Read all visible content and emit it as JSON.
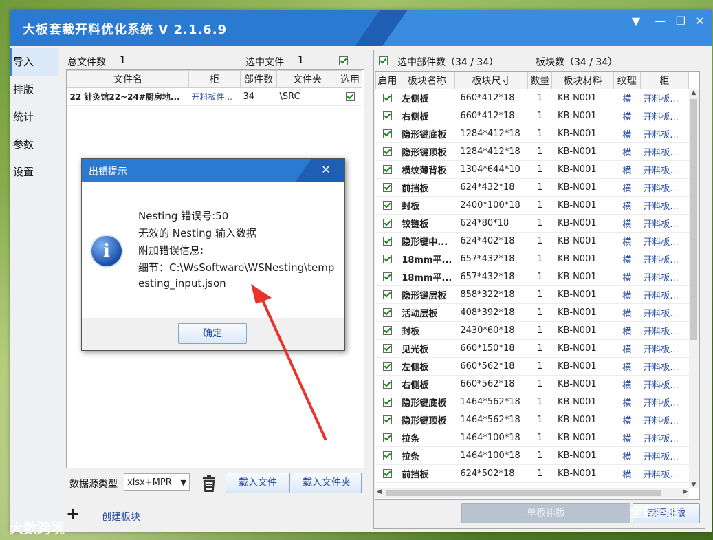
{
  "app": {
    "title": "大板套裁开料优化系统 V 2.1.6.9"
  },
  "window_controls": {
    "menu": "▼",
    "minimize": "—",
    "restore": "❐",
    "close": "✕"
  },
  "sidebar": {
    "items": [
      {
        "label": "导入",
        "active": true
      },
      {
        "label": "排版"
      },
      {
        "label": "统计"
      },
      {
        "label": "参数"
      },
      {
        "label": "设置"
      }
    ]
  },
  "left_panel": {
    "total_files_label": "总文件数",
    "total_files_value": "1",
    "selected_files_label": "选中文件",
    "selected_files_value": "1",
    "columns": [
      "文件名",
      "柜",
      "部件数",
      "文件夹",
      "选用"
    ],
    "rows": [
      {
        "name": "22 针灸馆22~24#厨房地...",
        "cabinet": "开料板件...",
        "count": "34",
        "folder": "\\SRC",
        "checked": true
      }
    ],
    "source_type_label": "数据源类型",
    "source_type_value": "xlsx+MPR",
    "load_file_button": "载入文件",
    "load_folder_button": "载入文件夹",
    "create_block_label": "创建板块"
  },
  "right_panel": {
    "selected_parts_label": "选中部件数（34 / 34）",
    "board_count_label": "板块数（34 / 34）",
    "columns": [
      "启用",
      "板块名称",
      "板块尺寸",
      "数量",
      "板块材料",
      "纹理",
      "柜"
    ],
    "rows": [
      {
        "name": "左侧板",
        "size": "660*412*18",
        "qty": "1",
        "material": "KB-N001",
        "grain": "横",
        "cabinet": "开料板..."
      },
      {
        "name": "右侧板",
        "size": "660*412*18",
        "qty": "1",
        "material": "KB-N001",
        "grain": "横",
        "cabinet": "开料板..."
      },
      {
        "name": "隐形键底板",
        "size": "1284*412*18",
        "qty": "1",
        "material": "KB-N001",
        "grain": "横",
        "cabinet": "开料板..."
      },
      {
        "name": "隐形键顶板",
        "size": "1284*412*18",
        "qty": "1",
        "material": "KB-N001",
        "grain": "横",
        "cabinet": "开料板..."
      },
      {
        "name": "横纹薄背板",
        "size": "1304*644*10",
        "qty": "1",
        "material": "KB-N001",
        "grain": "横",
        "cabinet": "开料板..."
      },
      {
        "name": "前挡板",
        "size": "624*432*18",
        "qty": "1",
        "material": "KB-N001",
        "grain": "横",
        "cabinet": "开料板..."
      },
      {
        "name": "封板",
        "size": "2400*100*18",
        "qty": "1",
        "material": "KB-N001",
        "grain": "横",
        "cabinet": "开料板..."
      },
      {
        "name": "铰链板",
        "size": "624*80*18",
        "qty": "1",
        "material": "KB-N001",
        "grain": "横",
        "cabinet": "开料板..."
      },
      {
        "name": "隐形键中...",
        "size": "624*402*18",
        "qty": "1",
        "material": "KB-N001",
        "grain": "横",
        "cabinet": "开料板..."
      },
      {
        "name": "18mm平...",
        "size": "657*432*18",
        "qty": "1",
        "material": "KB-N001",
        "grain": "横",
        "cabinet": "开料板..."
      },
      {
        "name": "18mm平...",
        "size": "657*432*18",
        "qty": "1",
        "material": "KB-N001",
        "grain": "横",
        "cabinet": "开料板..."
      },
      {
        "name": "隐形键层板",
        "size": "858*322*18",
        "qty": "1",
        "material": "KB-N001",
        "grain": "横",
        "cabinet": "开料板..."
      },
      {
        "name": "活动层板",
        "size": "408*392*18",
        "qty": "1",
        "material": "KB-N001",
        "grain": "横",
        "cabinet": "开料板..."
      },
      {
        "name": "封板",
        "size": "2430*60*18",
        "qty": "1",
        "material": "KB-N001",
        "grain": "横",
        "cabinet": "开料板..."
      },
      {
        "name": "见光板",
        "size": "660*150*18",
        "qty": "1",
        "material": "KB-N001",
        "grain": "横",
        "cabinet": "开料板..."
      },
      {
        "name": "左侧板",
        "size": "660*562*18",
        "qty": "1",
        "material": "KB-N001",
        "grain": "横",
        "cabinet": "开料板..."
      },
      {
        "name": "右侧板",
        "size": "660*562*18",
        "qty": "1",
        "material": "KB-N001",
        "grain": "横",
        "cabinet": "开料板..."
      },
      {
        "name": "隐形键底板",
        "size": "1464*562*18",
        "qty": "1",
        "material": "KB-N001",
        "grain": "横",
        "cabinet": "开料板..."
      },
      {
        "name": "隐形键顶板",
        "size": "1464*562*18",
        "qty": "1",
        "material": "KB-N001",
        "grain": "横",
        "cabinet": "开料板..."
      },
      {
        "name": "拉条",
        "size": "1464*100*18",
        "qty": "1",
        "material": "KB-N001",
        "grain": "横",
        "cabinet": "开料板..."
      },
      {
        "name": "拉条",
        "size": "1464*100*18",
        "qty": "1",
        "material": "KB-N001",
        "grain": "横",
        "cabinet": "开料板..."
      },
      {
        "name": "前挡板",
        "size": "624*502*18",
        "qty": "1",
        "material": "KB-N001",
        "grain": "横",
        "cabinet": "开料板..."
      }
    ],
    "single_layout_button": "单板排版",
    "nesting_button": "嵌套排版"
  },
  "dialog": {
    "title": "出错提示",
    "lines": [
      "Nesting 错误号:50",
      "无效的 Nesting 输入数据",
      "附加错误信息:",
      "细节：C:\\WsSoftware\\WSNesting\\temp",
      "esting_input.json"
    ],
    "ok_button": "确定"
  },
  "watermarks": {
    "bottom_left": "大数跨境",
    "bottom_right": "全屋E柜"
  },
  "colors": {
    "title_bar": "#2b7ad1",
    "arrow": "#e8322a",
    "check": "#128a12"
  }
}
